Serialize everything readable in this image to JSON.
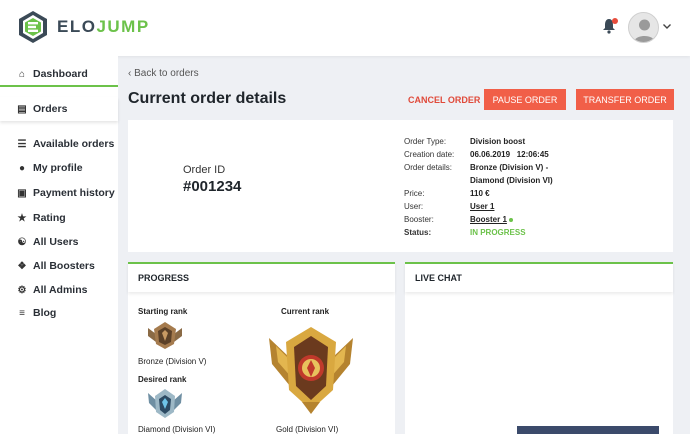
{
  "header": {
    "logo_prefix": "ELO",
    "logo_suffix": "JUMP",
    "icons": [
      "bell-icon",
      "avatar-icon",
      "chevron-down-icon"
    ]
  },
  "sidebar": {
    "items": [
      {
        "label": "Dashboard",
        "icon": "home-icon"
      },
      {
        "label": "Orders",
        "icon": "wallet-icon"
      },
      {
        "label": "Available orders",
        "icon": "list-icon"
      },
      {
        "label": "My profile",
        "icon": "user-icon"
      },
      {
        "label": "Payment history",
        "icon": "credit-card-icon"
      },
      {
        "label": "Rating",
        "icon": "star-icon"
      },
      {
        "label": "All Users",
        "icon": "users-icon"
      },
      {
        "label": "All Boosters",
        "icon": "compass-icon"
      },
      {
        "label": "All Admins",
        "icon": "cog-icon"
      },
      {
        "label": "Blog",
        "icon": "lines-icon"
      }
    ]
  },
  "main": {
    "back_label": "Back to orders",
    "title": "Current order details",
    "actions": {
      "cancel": "CANCEL ORDER",
      "pause": "PAUSE ORDER",
      "transfer": "TRANSFER ORDER"
    }
  },
  "order": {
    "id_label": "Order ID",
    "id_value": "#001234",
    "details": {
      "type_label": "Order Type:",
      "type_value": "Division boost",
      "date_label": "Creation date:",
      "date_value": "06.06.2019   12:06:45",
      "details_label": "Order details:",
      "details_value_1": "Bronze (Division V) -",
      "details_value_2": "Diamond (Division VI)",
      "price_label": "Price:",
      "price_value": "110 €",
      "user_label": "User:",
      "user_value": "User 1",
      "booster_label": "Booster:",
      "booster_value": "Booster 1",
      "status_label": "Status:",
      "status_value": "IN PROGRESS"
    }
  },
  "progress": {
    "title": "PROGRESS",
    "starting_label": "Starting rank",
    "starting_rank": "Bronze (Division V)",
    "desired_label": "Desired rank",
    "desired_rank": "Diamond (Division VI)",
    "current_label": "Current rank",
    "current_rank": "Gold (Division VI)"
  },
  "chat": {
    "title": "LIVE CHAT"
  },
  "colors": {
    "accent_green": "#6cc24a",
    "accent_red": "#f15f48",
    "dark_text": "#1f252b",
    "chat_input": "#3b4a6b"
  }
}
